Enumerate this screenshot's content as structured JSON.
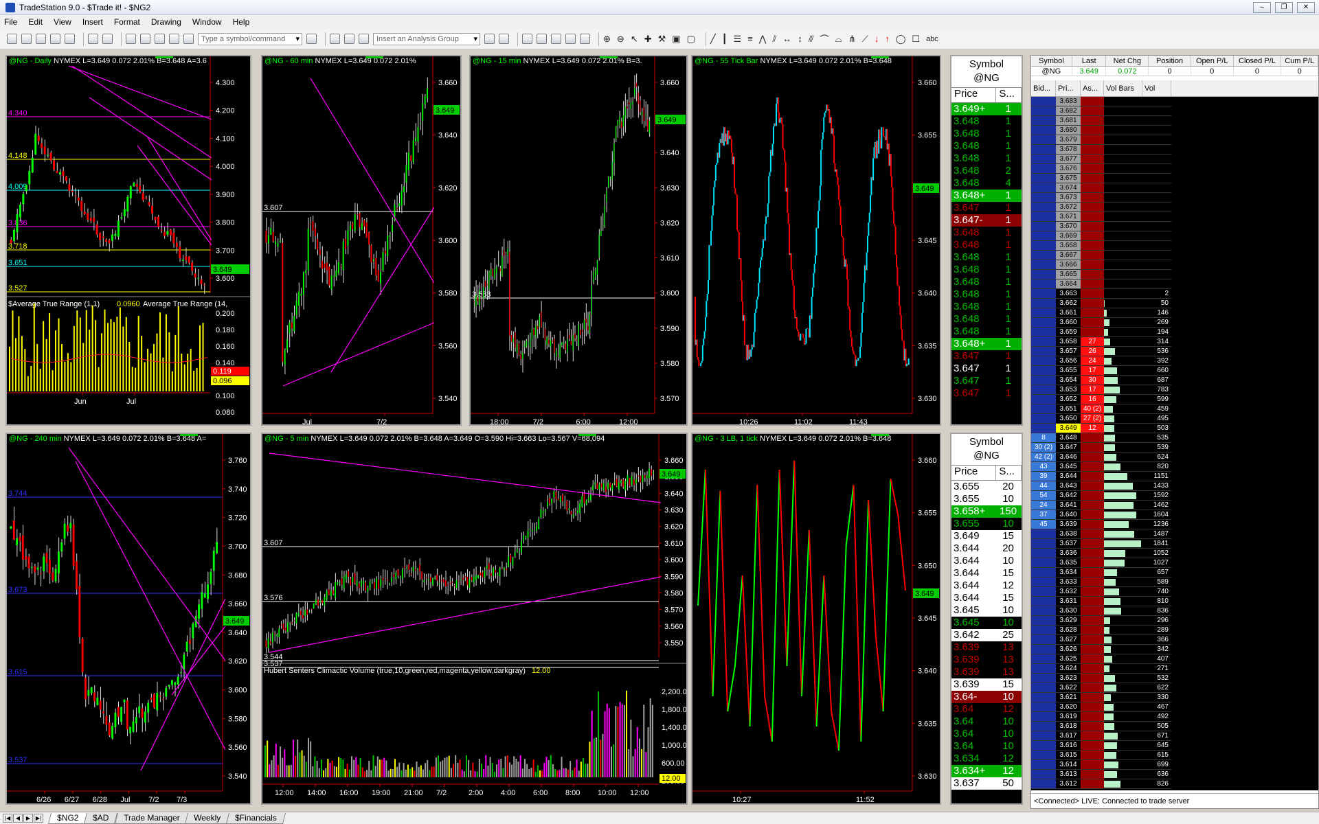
{
  "window": {
    "title": "TradeStation 9.0 - $Trade it! - $NG2"
  },
  "menu": [
    "File",
    "Edit",
    "View",
    "Insert",
    "Format",
    "Drawing",
    "Window",
    "Help"
  ],
  "toolbar": {
    "symbol_placeholder": "Type a symbol/command",
    "analysis_placeholder": "Insert an Analysis Group"
  },
  "charts": {
    "daily": {
      "sym": "@NG - Daily",
      "sec": "NYMEX  L=3.649  0.072  2.01%  B=3.648  A=3.6",
      "y_ticks": [
        "4.300",
        "4.200",
        "4.100",
        "4.000",
        "3.900",
        "3.800",
        "3.700",
        "3.600"
      ],
      "last": "3.649",
      "levels": [
        {
          "label": "4.340",
          "color": "#ff00ff"
        },
        {
          "label": "4.148",
          "color": "#ffff00"
        },
        {
          "label": "4.009",
          "color": "#00ffff"
        },
        {
          "label": "3.836",
          "color": "#ff00ff"
        },
        {
          "label": "3.718",
          "color": "#ffff00"
        },
        {
          "label": "3.651",
          "color": "#00ffff"
        },
        {
          "label": "3.527",
          "color": "#ffff00"
        }
      ],
      "sub_title": "$Average True Range (1,1)",
      "sub_val": "0.0960",
      "sub_title2": "Average True Range (14,",
      "sub_ticks": [
        "0.200",
        "0.180",
        "0.160",
        "0.140",
        "0.120",
        "0.100",
        "0.080"
      ],
      "sub_red": "0.119",
      "sub_yellow": "0.096",
      "x": [
        "Jun",
        "Jul"
      ]
    },
    "m60": {
      "sym": "@NG - 60 min",
      "sec": "NYMEX  L=3.649  0.072  2.01%",
      "y_ticks": [
        "3.660",
        "3.640",
        "3.620",
        "3.600",
        "3.580",
        "3.560",
        "3.540"
      ],
      "last": "3.649",
      "levels": [
        {
          "label": "3.607",
          "color": "#ffffff"
        }
      ],
      "x": [
        "Jul",
        "7/2"
      ]
    },
    "m15": {
      "sym": "@NG - 15 min",
      "sec": "NYMEX  L=3.649  0.072  2.01%  B=3.",
      "y_ticks": [
        "3.660",
        "3.650",
        "3.640",
        "3.630",
        "3.620",
        "3.610",
        "3.600",
        "3.590",
        "3.580",
        "3.570"
      ],
      "last": "3.649",
      "levels": [
        {
          "label": "3.583",
          "color": "#ffffff"
        }
      ],
      "x": [
        "18:00",
        "7/2",
        "6:00",
        "12:00"
      ]
    },
    "tick55": {
      "sym": "@NG - 55 Tick Bar",
      "sec": "NYMEX  L=3.649  0.072  2.01%  B=3.648",
      "y_ticks": [
        "3.660",
        "3.655",
        "3.650",
        "3.645",
        "3.640",
        "3.635",
        "3.630"
      ],
      "last": "3.649",
      "x": [
        "10:26",
        "11:02",
        "11:43"
      ]
    },
    "m240": {
      "sym": "@NG - 240 min",
      "sec": "NYMEX  L=3.649  0.072  2.01%  B=3.648  A=",
      "y_ticks": [
        "3.760",
        "3.740",
        "3.720",
        "3.700",
        "3.680",
        "3.660",
        "3.640",
        "3.620",
        "3.600",
        "3.580",
        "3.560",
        "3.540"
      ],
      "last": "3.649",
      "levels": [
        {
          "label": "3.744",
          "color": "#3030ff"
        },
        {
          "label": "3.673",
          "color": "#3030ff"
        },
        {
          "label": "3.615",
          "color": "#3030ff"
        },
        {
          "label": "3.537",
          "color": "#3030ff"
        }
      ],
      "x": [
        "6/26",
        "6/27",
        "6/28",
        "Jul",
        "7/2",
        "7/3"
      ]
    },
    "m5": {
      "sym": "@NG - 5 min",
      "sec": "NYMEX  L=3.649  0.072  2.01%  B=3.648  A=3.649  O=3.590  Hi=3.663  Lo=3.567  V=68,094",
      "y_ticks": [
        "3.660",
        "3.650",
        "3.640",
        "3.630",
        "3.620",
        "3.610",
        "3.600",
        "3.590",
        "3.580",
        "3.570",
        "3.560",
        "3.550"
      ],
      "last": "3.649",
      "levels": [
        {
          "label": "3.607",
          "color": "#ffffff"
        },
        {
          "label": "3.576",
          "color": "#ffffff"
        },
        {
          "label": "3.544",
          "color": "#ffffff"
        },
        {
          "label": "3.537",
          "color": "#ffffff"
        }
      ],
      "sub_title": "Hubert Senters Climactic Volume (true,10,green,red,magenta,yellow,darkgray)",
      "sub_val": "12.00",
      "sub_ticks": [
        "2,200.00",
        "1,800.00",
        "1,400.00",
        "1,000.00",
        "600.00",
        "200.00"
      ],
      "sub_last": "12.00",
      "x": [
        "12:00",
        "14:00",
        "16:00",
        "19:00",
        "21:00",
        "7/2",
        "2:00",
        "4:00",
        "6:00",
        "8:00",
        "10:00",
        "12:00"
      ]
    },
    "lb3": {
      "sym": "@NG - 3 LB, 1 tick",
      "sec": "NYMEX  L=3.649  0.072  2.01%  B=3.648",
      "y_ticks": [
        "3.660",
        "3.655",
        "3.650",
        "3.645",
        "3.640",
        "3.635",
        "3.630"
      ],
      "last": "3.649",
      "x": [
        "10:27",
        "11:52"
      ]
    }
  },
  "dom1": {
    "header": "Symbol",
    "symbol": "@NG",
    "col_price": "Price",
    "col_size": "S...",
    "rows": [
      [
        "3.649+",
        "1",
        "lg",
        "g"
      ],
      [
        "3.648",
        "1",
        "b",
        "g"
      ],
      [
        "3.648",
        "1",
        "b",
        "g"
      ],
      [
        "3.648",
        "1",
        "b",
        "g"
      ],
      [
        "3.648",
        "1",
        "b",
        "g"
      ],
      [
        "3.648",
        "2",
        "b",
        "g"
      ],
      [
        "3.648",
        "4",
        "b",
        "g"
      ],
      [
        "3.648+",
        "1",
        "lg",
        "g"
      ],
      [
        "3.647",
        "1",
        "b",
        "r"
      ],
      [
        "3.647-",
        "1",
        "dr",
        "r"
      ],
      [
        "3.648",
        "1",
        "b",
        "r"
      ],
      [
        "3.648",
        "1",
        "b",
        "r"
      ],
      [
        "3.648",
        "1",
        "b",
        "g"
      ],
      [
        "3.648",
        "1",
        "b",
        "g"
      ],
      [
        "3.648",
        "1",
        "b",
        "g"
      ],
      [
        "3.648",
        "1",
        "b",
        "g"
      ],
      [
        "3.648",
        "1",
        "b",
        "g"
      ],
      [
        "3.648",
        "1",
        "b",
        "g"
      ],
      [
        "3.648",
        "1",
        "b",
        "g"
      ],
      [
        "3.648+",
        "1",
        "lg",
        "g"
      ],
      [
        "3.647",
        "1",
        "b",
        "r"
      ],
      [
        "3.647",
        "1",
        "b",
        "w"
      ],
      [
        "3.647",
        "1",
        "b",
        "g"
      ],
      [
        "3.647",
        "1",
        "b",
        "r"
      ]
    ]
  },
  "dom2": {
    "header": "Symbol",
    "symbol": "@NG",
    "col_price": "Price",
    "col_size": "S...",
    "rows": [
      [
        "3.655",
        "20",
        "w",
        "k"
      ],
      [
        "3.655",
        "10",
        "w",
        "k"
      ],
      [
        "3.658+",
        "150",
        "lg",
        "k"
      ],
      [
        "3.655",
        "10",
        "b",
        "g"
      ],
      [
        "3.649",
        "15",
        "w",
        "k"
      ],
      [
        "3.644",
        "20",
        "w",
        "k"
      ],
      [
        "3.644",
        "10",
        "w",
        "k"
      ],
      [
        "3.644",
        "15",
        "w",
        "k"
      ],
      [
        "3.644",
        "12",
        "w",
        "k"
      ],
      [
        "3.644",
        "15",
        "w",
        "k"
      ],
      [
        "3.645",
        "10",
        "w",
        "k"
      ],
      [
        "3.645",
        "10",
        "b",
        "g"
      ],
      [
        "3.642",
        "25",
        "w",
        "k"
      ],
      [
        "3.639",
        "13",
        "b",
        "r"
      ],
      [
        "3.639",
        "13",
        "b",
        "r"
      ],
      [
        "3.639",
        "13",
        "b",
        "r"
      ],
      [
        "3.639",
        "15",
        "w",
        "k"
      ],
      [
        "3.64-",
        "10",
        "dr",
        "r"
      ],
      [
        "3.64",
        "12",
        "b",
        "r"
      ],
      [
        "3.64",
        "10",
        "b",
        "g"
      ],
      [
        "3.64",
        "10",
        "b",
        "g"
      ],
      [
        "3.64",
        "10",
        "b",
        "g"
      ],
      [
        "3.634",
        "12",
        "b",
        "g"
      ],
      [
        "3.634+",
        "12",
        "lg",
        "g"
      ],
      [
        "3.637",
        "50",
        "w",
        "k"
      ]
    ]
  },
  "matrix": {
    "headers": [
      "Symbol",
      "Last",
      "Net Chg",
      "Position",
      "Open P/L",
      "Closed P/L",
      "Cum P/L"
    ],
    "values": [
      "@NG",
      "3.649",
      "0.072",
      "0",
      "0",
      "0",
      "0"
    ],
    "ladder_headers": [
      "Bid...",
      "Pri...",
      "As...",
      "Vol Bars",
      "Vol"
    ],
    "status": "<Connected>  LIVE:  Connected to trade server",
    "ladder": [
      [
        "",
        "3.683",
        "",
        "",
        ""
      ],
      [
        "",
        "3.682",
        "",
        "",
        ""
      ],
      [
        "",
        "3.681",
        "",
        "",
        ""
      ],
      [
        "",
        "3.680",
        "",
        "",
        ""
      ],
      [
        "",
        "3.679",
        "",
        "",
        ""
      ],
      [
        "",
        "3.678",
        "",
        "",
        ""
      ],
      [
        "",
        "3.677",
        "",
        "",
        ""
      ],
      [
        "",
        "3.676",
        "",
        "",
        ""
      ],
      [
        "",
        "3.675",
        "",
        "",
        ""
      ],
      [
        "",
        "3.674",
        "",
        "",
        ""
      ],
      [
        "",
        "3.673",
        "",
        "",
        ""
      ],
      [
        "",
        "3.672",
        "",
        "",
        ""
      ],
      [
        "",
        "3.671",
        "",
        "",
        ""
      ],
      [
        "",
        "3.670",
        "",
        "",
        ""
      ],
      [
        "",
        "3.669",
        "",
        "",
        ""
      ],
      [
        "",
        "3.668",
        "",
        "",
        ""
      ],
      [
        "",
        "3.667",
        "",
        "",
        ""
      ],
      [
        "",
        "3.666",
        "",
        "",
        ""
      ],
      [
        "",
        "3.665",
        "",
        "",
        ""
      ],
      [
        "",
        "3.664",
        "",
        "",
        ""
      ],
      [
        "",
        "3.663",
        "",
        "",
        "2"
      ],
      [
        "",
        "3.662",
        "",
        "",
        "50"
      ],
      [
        "",
        "3.661",
        "",
        "",
        "146"
      ],
      [
        "",
        "3.660",
        "",
        "",
        "269"
      ],
      [
        "",
        "3.659",
        "",
        "",
        "194"
      ],
      [
        "",
        "3.658",
        "27",
        "",
        "314"
      ],
      [
        "",
        "3.657",
        "26",
        "",
        "536"
      ],
      [
        "",
        "3.656",
        "24",
        "",
        "392"
      ],
      [
        "",
        "3.655",
        "17",
        "",
        "660"
      ],
      [
        "",
        "3.654",
        "30",
        "",
        "687"
      ],
      [
        "",
        "3.653",
        "17",
        "",
        "783"
      ],
      [
        "",
        "3.652",
        "16",
        "",
        "599"
      ],
      [
        "",
        "3.651",
        "40 (2)",
        "",
        "459"
      ],
      [
        "",
        "3.650",
        "27 (2)",
        "",
        "495"
      ],
      [
        "",
        "3.649",
        "12",
        "",
        "503"
      ],
      [
        "8",
        "3.648",
        "",
        "",
        "535"
      ],
      [
        "30 (2)",
        "3.647",
        "",
        "",
        "539"
      ],
      [
        "42 (2)",
        "3.646",
        "",
        "",
        "624"
      ],
      [
        "43",
        "3.645",
        "",
        "",
        "820"
      ],
      [
        "39",
        "3.644",
        "",
        "",
        "1151"
      ],
      [
        "44",
        "3.643",
        "",
        "",
        "1433"
      ],
      [
        "54",
        "3.642",
        "",
        "",
        "1592"
      ],
      [
        "24",
        "3.641",
        "",
        "",
        "1462"
      ],
      [
        "37",
        "3.640",
        "",
        "",
        "1604"
      ],
      [
        "45",
        "3.639",
        "",
        "",
        "1236"
      ],
      [
        "",
        "3.638",
        "",
        "",
        "1487"
      ],
      [
        "",
        "3.637",
        "",
        "",
        "1841"
      ],
      [
        "",
        "3.636",
        "",
        "",
        "1052"
      ],
      [
        "",
        "3.635",
        "",
        "",
        "1027"
      ],
      [
        "",
        "3.634",
        "",
        "",
        "657"
      ],
      [
        "",
        "3.633",
        "",
        "",
        "589"
      ],
      [
        "",
        "3.632",
        "",
        "",
        "740"
      ],
      [
        "",
        "3.631",
        "",
        "",
        "810"
      ],
      [
        "",
        "3.630",
        "",
        "",
        "836"
      ],
      [
        "",
        "3.629",
        "",
        "",
        "296"
      ],
      [
        "",
        "3.628",
        "",
        "",
        "289"
      ],
      [
        "",
        "3.627",
        "",
        "",
        "366"
      ],
      [
        "",
        "3.626",
        "",
        "",
        "342"
      ],
      [
        "",
        "3.625",
        "",
        "",
        "407"
      ],
      [
        "",
        "3.624",
        "",
        "",
        "271"
      ],
      [
        "",
        "3.623",
        "",
        "",
        "532"
      ],
      [
        "",
        "3.622",
        "",
        "",
        "622"
      ],
      [
        "",
        "3.621",
        "",
        "",
        "330"
      ],
      [
        "",
        "3.620",
        "",
        "",
        "467"
      ],
      [
        "",
        "3.619",
        "",
        "",
        "492"
      ],
      [
        "",
        "3.618",
        "",
        "",
        "505"
      ],
      [
        "",
        "3.617",
        "",
        "",
        "671"
      ],
      [
        "",
        "3.616",
        "",
        "",
        "645"
      ],
      [
        "",
        "3.615",
        "",
        "",
        "615"
      ],
      [
        "",
        "3.614",
        "",
        "",
        "699"
      ],
      [
        "",
        "3.613",
        "",
        "",
        "636"
      ],
      [
        "",
        "3.612",
        "",
        "",
        "826"
      ]
    ]
  },
  "tabs": [
    "$NG2",
    "$AD",
    "Trade Manager",
    "Weekly",
    "$Financials"
  ],
  "colors": {
    "up": "#00ff00",
    "down": "#ff0000",
    "cyan": "#00e5ff",
    "magenta": "#ff00ff",
    "yellow": "#ffff00"
  }
}
